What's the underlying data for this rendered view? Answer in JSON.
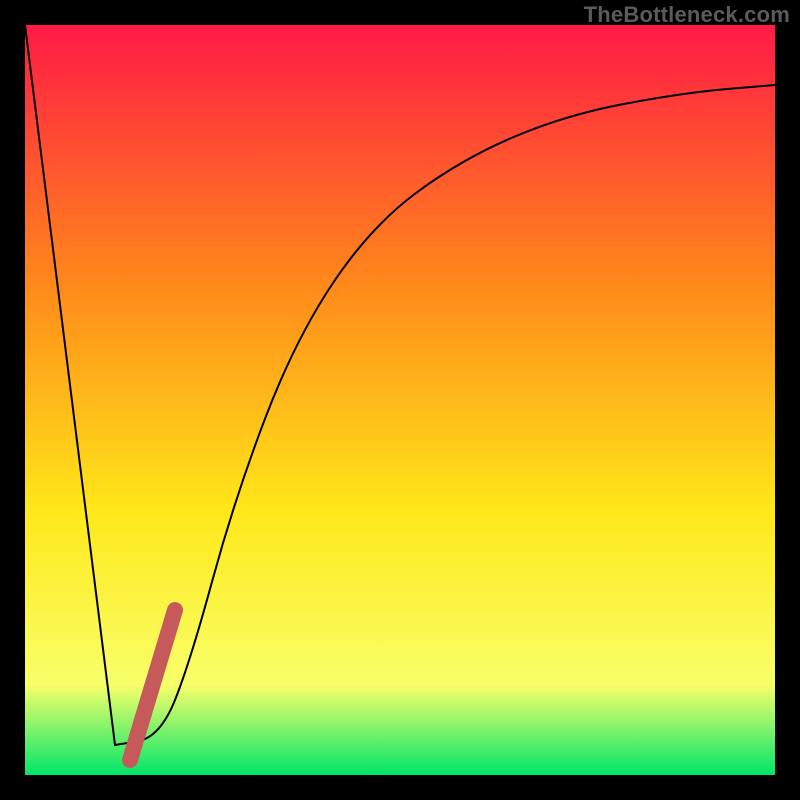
{
  "watermark": "TheBottleneck.com",
  "colors": {
    "background": "#000000",
    "gradient_top": "#ff1a45",
    "gradient_mid1": "#ff8a1a",
    "gradient_mid2": "#ffe81a",
    "gradient_mid3": "#f8ff6a",
    "gradient_bottom": "#00e56a",
    "curve": "#000000",
    "marker": "#c65a5a"
  },
  "chart_data": {
    "type": "line",
    "title": "",
    "xlabel": "",
    "ylabel": "",
    "xlim": [
      0,
      100
    ],
    "ylim": [
      0,
      100
    ],
    "series": [
      {
        "name": "bottleneck-curve",
        "x": [
          0,
          12,
          18,
          22,
          28,
          36,
          46,
          58,
          72,
          88,
          100
        ],
        "values": [
          100,
          4,
          5,
          15,
          37,
          58,
          73,
          82,
          88,
          91,
          92
        ]
      }
    ],
    "marker_segment": {
      "name": "highlighted-range",
      "x1": 14,
      "y1": 2,
      "x2": 20,
      "y2": 22
    },
    "annotations": []
  }
}
